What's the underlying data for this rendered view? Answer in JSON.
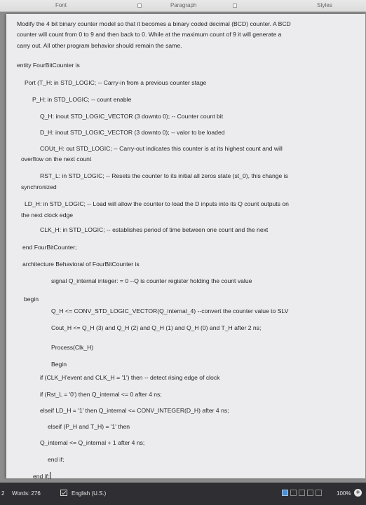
{
  "ribbon": {
    "font_group": "Font",
    "paragraph_group": "Paragraph",
    "styles_group": "Styles"
  },
  "document": {
    "lines": [
      "Modify the 4 bit binary counter model so that it becomes a binary coded decimal (BCD) counter. A BCD",
      "counter will count from 0 to 9 and then back to 0. While at the maximum count of 9 it will generate a",
      "carry out. All other program behavior should remain the same.",
      "entity FourBitCounter is",
      "Port (T_H: in STD_LOGIC; -- Carry-in from a previous counter stage",
      "P_H: in STD_LOGIC; -- count enable",
      "Q_H: inout STD_LOGIC_VECTOR (3 downto 0); -- Counter count bit",
      "D_H: inout STD_LOGIC_VECTOR (3 downto 0); -- valor to be loaded",
      "COUt_H: out STD_LOGIC; -- Carry-out indicates this counter is at its highest count and will",
      "overflow on the next count",
      "RST_L: in STD_LOGIC; -- Resets the counter to its initial all zeros state (st_0), this change is",
      "synchronized",
      "LD_H: in STD_LOGIC; -- Load will allow the counter to load the D inputs into its Q count outputs on",
      "the next clock edge",
      "CLK_H: in STD_LOGIC; -- establishes period of time between one count and the next",
      "end FourBitCounter;",
      "architecture Behavioral of FourBitCounter is",
      "signal Q_internal integer: = 0 --Q is counter register holding the count value",
      "begin",
      "Q_H <= CONV_STD_LOGIC_VECTOR(Q_internal_4) --convert the counter value to SLV",
      "Cout_H <= Q_H (3) and Q_H (2) and Q_H (1) and Q_H (0) and T_H after 2 ns;",
      "Process(Clk_H)",
      "Begin",
      "if (CLK_H'event and CLK_H = '1') then -- detect rising edge of clock",
      "if (Rst_L = '0') then Q_internal <= 0 after 4 ns;",
      "elseif LD_H = '1' then Q_internal <= CONV_INTEGER(D_H) after 4 ns;",
      "elseif (P_H and T_H) = '1' then",
      "Q_internal <= Q_internal + 1 after 4 ns;",
      "end if;",
      "end if;"
    ]
  },
  "status": {
    "page_fragment": "2",
    "words": "Words: 276",
    "language": "English (U.S.)",
    "zoom": "100%",
    "zoom_in": "+"
  },
  "colors": {
    "status_bar": "#2f2f33",
    "page": "#ececee",
    "accent_view": "#4a8fd1"
  }
}
